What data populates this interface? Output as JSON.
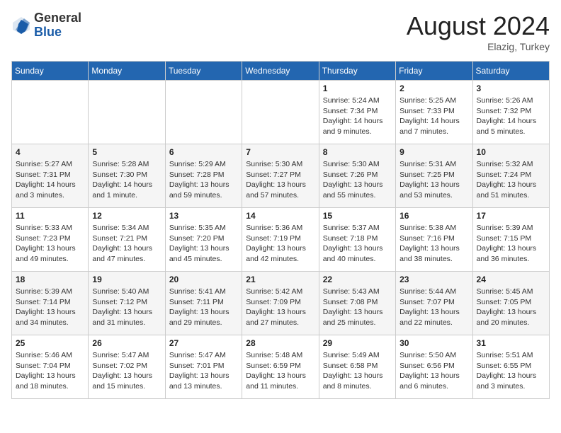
{
  "header": {
    "logo_general": "General",
    "logo_blue": "Blue",
    "month_year": "August 2024",
    "location": "Elazig, Turkey"
  },
  "days_of_week": [
    "Sunday",
    "Monday",
    "Tuesday",
    "Wednesday",
    "Thursday",
    "Friday",
    "Saturday"
  ],
  "weeks": [
    [
      {
        "day": "",
        "info": ""
      },
      {
        "day": "",
        "info": ""
      },
      {
        "day": "",
        "info": ""
      },
      {
        "day": "",
        "info": ""
      },
      {
        "day": "1",
        "info": "Sunrise: 5:24 AM\nSunset: 7:34 PM\nDaylight: 14 hours\nand 9 minutes."
      },
      {
        "day": "2",
        "info": "Sunrise: 5:25 AM\nSunset: 7:33 PM\nDaylight: 14 hours\nand 7 minutes."
      },
      {
        "day": "3",
        "info": "Sunrise: 5:26 AM\nSunset: 7:32 PM\nDaylight: 14 hours\nand 5 minutes."
      }
    ],
    [
      {
        "day": "4",
        "info": "Sunrise: 5:27 AM\nSunset: 7:31 PM\nDaylight: 14 hours\nand 3 minutes."
      },
      {
        "day": "5",
        "info": "Sunrise: 5:28 AM\nSunset: 7:30 PM\nDaylight: 14 hours\nand 1 minute."
      },
      {
        "day": "6",
        "info": "Sunrise: 5:29 AM\nSunset: 7:28 PM\nDaylight: 13 hours\nand 59 minutes."
      },
      {
        "day": "7",
        "info": "Sunrise: 5:30 AM\nSunset: 7:27 PM\nDaylight: 13 hours\nand 57 minutes."
      },
      {
        "day": "8",
        "info": "Sunrise: 5:30 AM\nSunset: 7:26 PM\nDaylight: 13 hours\nand 55 minutes."
      },
      {
        "day": "9",
        "info": "Sunrise: 5:31 AM\nSunset: 7:25 PM\nDaylight: 13 hours\nand 53 minutes."
      },
      {
        "day": "10",
        "info": "Sunrise: 5:32 AM\nSunset: 7:24 PM\nDaylight: 13 hours\nand 51 minutes."
      }
    ],
    [
      {
        "day": "11",
        "info": "Sunrise: 5:33 AM\nSunset: 7:23 PM\nDaylight: 13 hours\nand 49 minutes."
      },
      {
        "day": "12",
        "info": "Sunrise: 5:34 AM\nSunset: 7:21 PM\nDaylight: 13 hours\nand 47 minutes."
      },
      {
        "day": "13",
        "info": "Sunrise: 5:35 AM\nSunset: 7:20 PM\nDaylight: 13 hours\nand 45 minutes."
      },
      {
        "day": "14",
        "info": "Sunrise: 5:36 AM\nSunset: 7:19 PM\nDaylight: 13 hours\nand 42 minutes."
      },
      {
        "day": "15",
        "info": "Sunrise: 5:37 AM\nSunset: 7:18 PM\nDaylight: 13 hours\nand 40 minutes."
      },
      {
        "day": "16",
        "info": "Sunrise: 5:38 AM\nSunset: 7:16 PM\nDaylight: 13 hours\nand 38 minutes."
      },
      {
        "day": "17",
        "info": "Sunrise: 5:39 AM\nSunset: 7:15 PM\nDaylight: 13 hours\nand 36 minutes."
      }
    ],
    [
      {
        "day": "18",
        "info": "Sunrise: 5:39 AM\nSunset: 7:14 PM\nDaylight: 13 hours\nand 34 minutes."
      },
      {
        "day": "19",
        "info": "Sunrise: 5:40 AM\nSunset: 7:12 PM\nDaylight: 13 hours\nand 31 minutes."
      },
      {
        "day": "20",
        "info": "Sunrise: 5:41 AM\nSunset: 7:11 PM\nDaylight: 13 hours\nand 29 minutes."
      },
      {
        "day": "21",
        "info": "Sunrise: 5:42 AM\nSunset: 7:09 PM\nDaylight: 13 hours\nand 27 minutes."
      },
      {
        "day": "22",
        "info": "Sunrise: 5:43 AM\nSunset: 7:08 PM\nDaylight: 13 hours\nand 25 minutes."
      },
      {
        "day": "23",
        "info": "Sunrise: 5:44 AM\nSunset: 7:07 PM\nDaylight: 13 hours\nand 22 minutes."
      },
      {
        "day": "24",
        "info": "Sunrise: 5:45 AM\nSunset: 7:05 PM\nDaylight: 13 hours\nand 20 minutes."
      }
    ],
    [
      {
        "day": "25",
        "info": "Sunrise: 5:46 AM\nSunset: 7:04 PM\nDaylight: 13 hours\nand 18 minutes."
      },
      {
        "day": "26",
        "info": "Sunrise: 5:47 AM\nSunset: 7:02 PM\nDaylight: 13 hours\nand 15 minutes."
      },
      {
        "day": "27",
        "info": "Sunrise: 5:47 AM\nSunset: 7:01 PM\nDaylight: 13 hours\nand 13 minutes."
      },
      {
        "day": "28",
        "info": "Sunrise: 5:48 AM\nSunset: 6:59 PM\nDaylight: 13 hours\nand 11 minutes."
      },
      {
        "day": "29",
        "info": "Sunrise: 5:49 AM\nSunset: 6:58 PM\nDaylight: 13 hours\nand 8 minutes."
      },
      {
        "day": "30",
        "info": "Sunrise: 5:50 AM\nSunset: 6:56 PM\nDaylight: 13 hours\nand 6 minutes."
      },
      {
        "day": "31",
        "info": "Sunrise: 5:51 AM\nSunset: 6:55 PM\nDaylight: 13 hours\nand 3 minutes."
      }
    ]
  ]
}
